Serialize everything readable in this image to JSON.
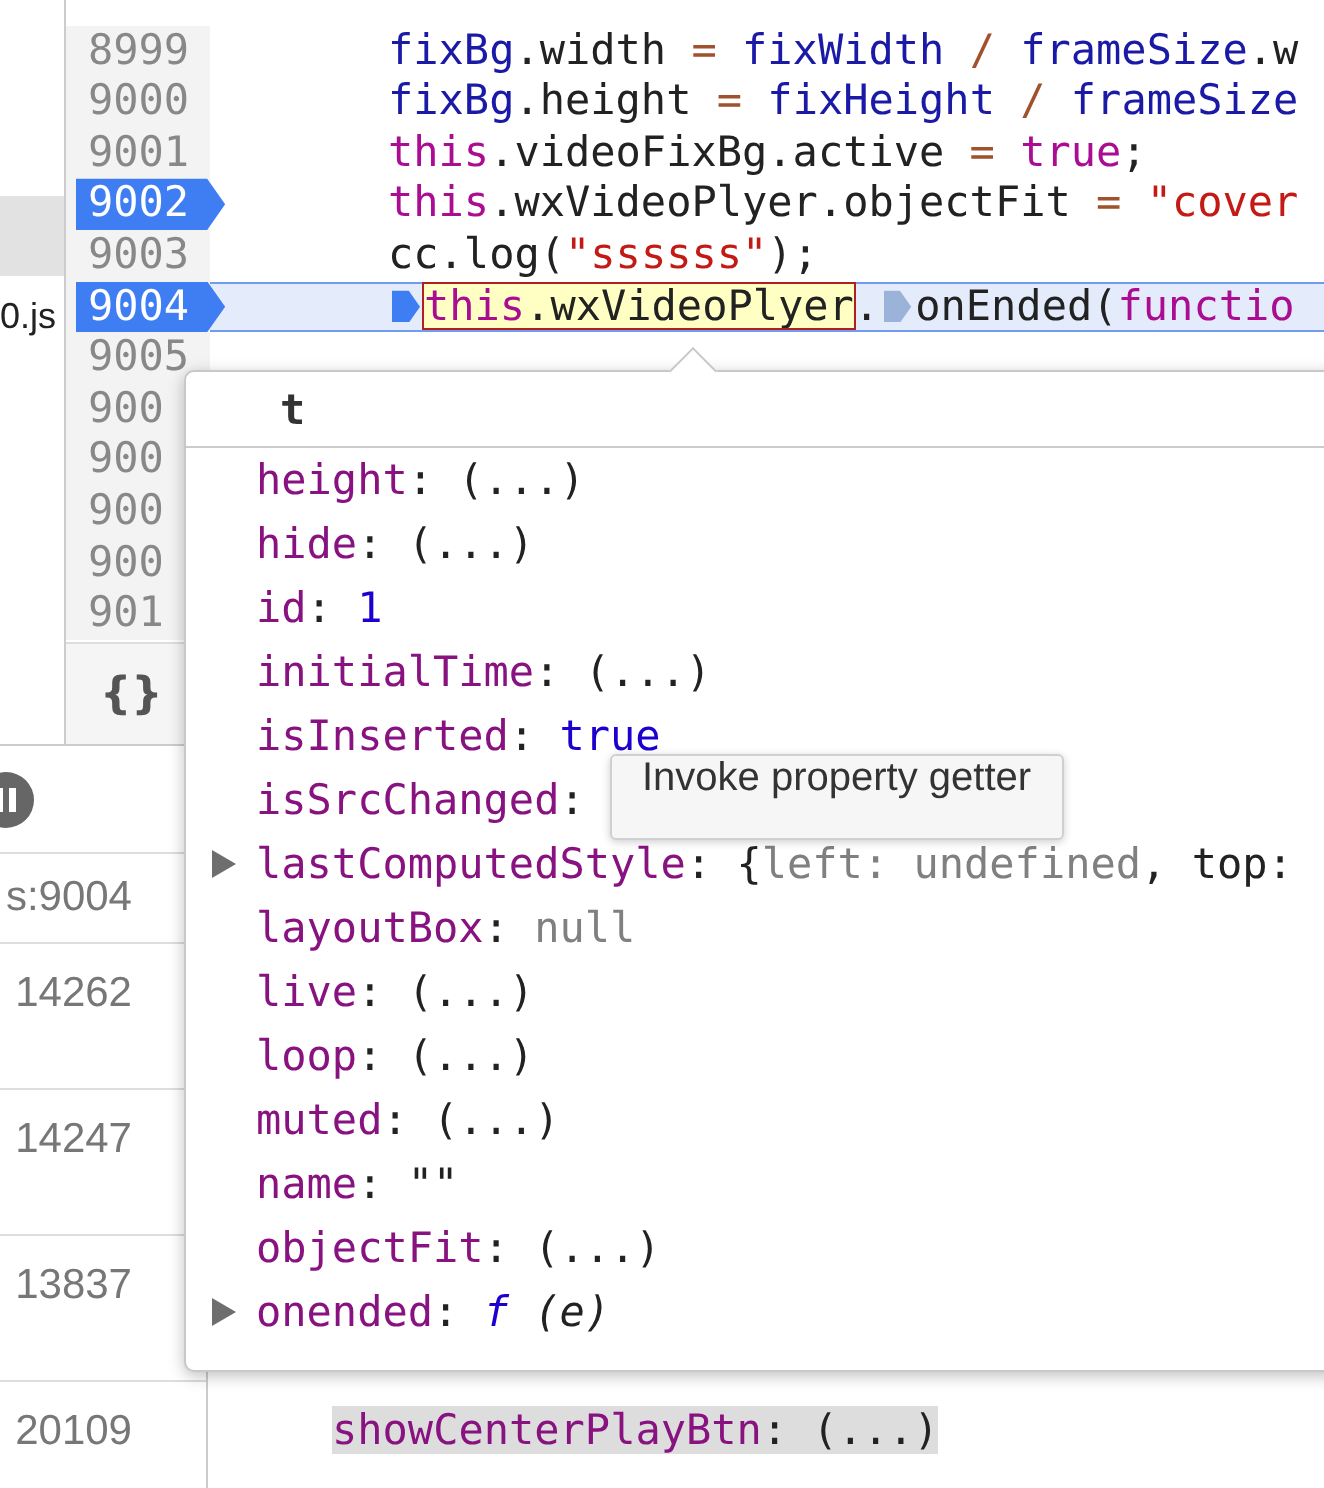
{
  "files": [
    {
      "selected": true
    },
    {
      "label": "0.js",
      "selected": false
    }
  ],
  "editor": {
    "lines": [
      {
        "number": "8999",
        "breakpoint": false,
        "current": false,
        "tokens": [
          {
            "kind": "var",
            "text": "fixBg"
          },
          {
            "kind": "plain",
            "text": ".width"
          },
          {
            "kind": "op",
            "text": " = "
          },
          {
            "kind": "var",
            "text": "fixWidth"
          },
          {
            "kind": "op",
            "text": " / "
          },
          {
            "kind": "var",
            "text": "frameSize"
          },
          {
            "kind": "plain",
            "text": ".w"
          }
        ]
      },
      {
        "number": "9000",
        "breakpoint": false,
        "current": false,
        "tokens": [
          {
            "kind": "var",
            "text": "fixBg"
          },
          {
            "kind": "plain",
            "text": ".height"
          },
          {
            "kind": "op",
            "text": " = "
          },
          {
            "kind": "var",
            "text": "fixHeight"
          },
          {
            "kind": "op",
            "text": " / "
          },
          {
            "kind": "var",
            "text": "frameSize"
          }
        ]
      },
      {
        "number": "9001",
        "breakpoint": false,
        "current": false,
        "tokens": [
          {
            "kind": "kw",
            "text": "this"
          },
          {
            "kind": "plain",
            "text": ".videoFixBg.active"
          },
          {
            "kind": "op",
            "text": " = "
          },
          {
            "kind": "kw",
            "text": "true"
          },
          {
            "kind": "plain",
            "text": ";"
          }
        ]
      },
      {
        "number": "9002",
        "breakpoint": true,
        "current": false,
        "tokens": [
          {
            "kind": "kw",
            "text": "this"
          },
          {
            "kind": "plain",
            "text": ".wxVideoPlyer.objectFit"
          },
          {
            "kind": "op",
            "text": " = "
          },
          {
            "kind": "str",
            "text": "\"cover"
          }
        ]
      },
      {
        "number": "9003",
        "breakpoint": false,
        "current": false,
        "tokens": [
          {
            "kind": "plain",
            "text": "cc.log("
          },
          {
            "kind": "str",
            "text": "\"ssssss\""
          },
          {
            "kind": "plain",
            "text": ");"
          }
        ]
      },
      {
        "number": "9004",
        "breakpoint": true,
        "current": true,
        "tokens": [
          {
            "kind": "marker",
            "active": true
          },
          {
            "kind": "hover",
            "tokens": [
              {
                "kind": "kw",
                "text": "this"
              },
              {
                "kind": "plain",
                "text": ".wxVideoPlyer"
              }
            ]
          },
          {
            "kind": "plain",
            "text": "."
          },
          {
            "kind": "marker",
            "active": false
          },
          {
            "kind": "plain",
            "text": "onEnded("
          },
          {
            "kind": "kw",
            "text": "functio"
          }
        ]
      },
      {
        "number": "9005",
        "breakpoint": false,
        "current": false
      },
      {
        "number": "900",
        "breakpoint": false
      },
      {
        "number": "900",
        "breakpoint": false
      },
      {
        "number": "900",
        "breakpoint": false
      },
      {
        "number": "900",
        "breakpoint": false
      },
      {
        "number": "901",
        "breakpoint": false
      }
    ],
    "pretty_print": "{}"
  },
  "call_stack": {
    "location": "s:9004",
    "items": [
      "14262",
      "14247",
      "13837",
      "20109"
    ]
  },
  "scope": [
    {
      "tokens": [
        {
          "kind": "key",
          "text": "showCenterPlayBtn"
        },
        {
          "kind": "plain",
          "text": ": (...)"
        }
      ]
    }
  ],
  "popover": {
    "title": "t",
    "properties": [
      {
        "expandable": false,
        "tokens": [
          {
            "kind": "key",
            "text": "height"
          },
          {
            "kind": "plain",
            "text": ": (...)"
          }
        ]
      },
      {
        "expandable": false,
        "tokens": [
          {
            "kind": "key",
            "text": "hide"
          },
          {
            "kind": "plain",
            "text": ": (...)"
          }
        ]
      },
      {
        "expandable": false,
        "tokens": [
          {
            "kind": "key",
            "text": "id"
          },
          {
            "kind": "plain",
            "text": ": "
          },
          {
            "kind": "num",
            "text": "1"
          }
        ]
      },
      {
        "expandable": false,
        "tokens": [
          {
            "kind": "key",
            "text": "initialTime"
          },
          {
            "kind": "plain",
            "text": ": (...)"
          }
        ]
      },
      {
        "expandable": false,
        "tokens": [
          {
            "kind": "key",
            "text": "isInserted"
          },
          {
            "kind": "plain",
            "text": ": "
          },
          {
            "kind": "num",
            "text": "true"
          }
        ]
      },
      {
        "expandable": false,
        "tokens": [
          {
            "kind": "key",
            "text": "isSrcChanged"
          },
          {
            "kind": "plain",
            "text": ":"
          }
        ]
      },
      {
        "expandable": true,
        "tokens": [
          {
            "kind": "key",
            "text": "lastComputedStyle"
          },
          {
            "kind": "plain",
            "text": ": {"
          },
          {
            "kind": "null",
            "text": "left: undefined"
          },
          {
            "kind": "plain",
            "text": ", top:"
          }
        ]
      },
      {
        "expandable": false,
        "tokens": [
          {
            "kind": "key",
            "text": "layoutBox"
          },
          {
            "kind": "plain",
            "text": ": "
          },
          {
            "kind": "null",
            "text": "null"
          }
        ]
      },
      {
        "expandable": false,
        "tokens": [
          {
            "kind": "key",
            "text": "live"
          },
          {
            "kind": "plain",
            "text": ": (...)"
          }
        ]
      },
      {
        "expandable": false,
        "tokens": [
          {
            "kind": "key",
            "text": "loop"
          },
          {
            "kind": "plain",
            "text": ": (...)"
          }
        ]
      },
      {
        "expandable": false,
        "tokens": [
          {
            "kind": "key",
            "text": "muted"
          },
          {
            "kind": "plain",
            "text": ": (...)"
          }
        ]
      },
      {
        "expandable": false,
        "tokens": [
          {
            "kind": "key",
            "text": "name"
          },
          {
            "kind": "plain",
            "text": ": \"\""
          }
        ]
      },
      {
        "expandable": false,
        "tokens": [
          {
            "kind": "key",
            "text": "objectFit"
          },
          {
            "kind": "plain",
            "text": ": (...)"
          }
        ]
      },
      {
        "expandable": true,
        "tokens": [
          {
            "kind": "key",
            "text": "onended"
          },
          {
            "kind": "plain",
            "text": ": "
          },
          {
            "kind": "fn",
            "text": "f"
          },
          {
            "kind": "italic",
            "text": " (e)"
          }
        ]
      }
    ]
  },
  "tooltip": "Invoke property getter"
}
